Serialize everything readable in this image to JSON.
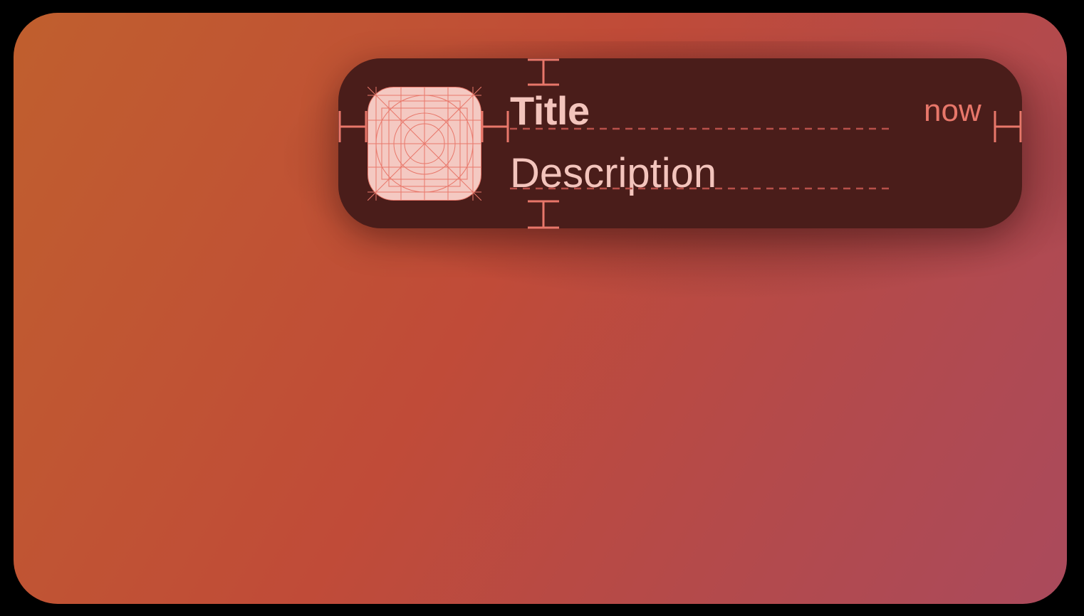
{
  "notification": {
    "title": "Title",
    "description": "Description",
    "timestamp": "now",
    "app_icon": "app-icon-template-grid"
  },
  "colors": {
    "background_start": "#c05f2e",
    "background_end": "#aa4a5c",
    "notification_bg": "#4a1d1a",
    "text_primary": "#f3c4bc",
    "accent_guides": "#e8776a",
    "icon_fill": "#f4c9c2"
  }
}
